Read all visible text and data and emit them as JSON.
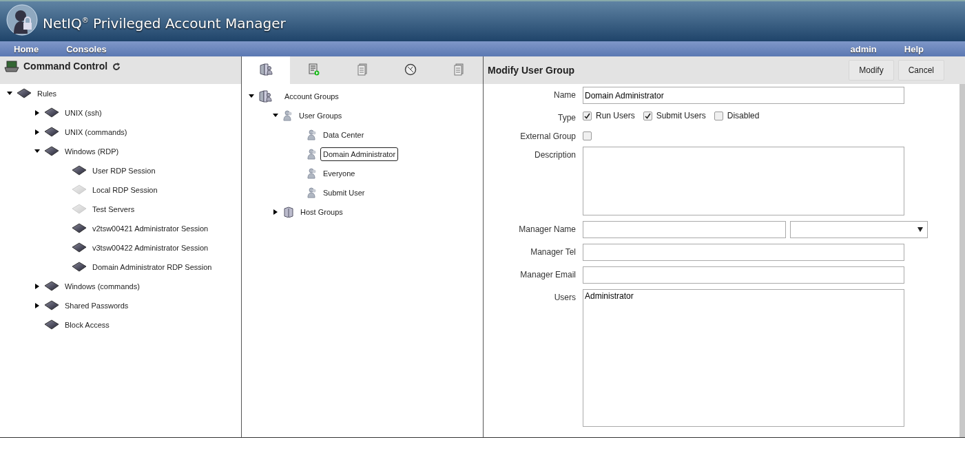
{
  "app": {
    "title": "NetIQ$^{®}$ Privileged Account Manager"
  },
  "nav": {
    "left": [
      "Home",
      "Consoles"
    ],
    "right": [
      "admin",
      "Help"
    ]
  },
  "left_panel": {
    "title": "Command Control",
    "tree": [
      {
        "kind": "group",
        "label": "Rules",
        "expanded": true,
        "children": [
          {
            "kind": "group",
            "label": "UNIX (ssh)",
            "expanded": false
          },
          {
            "kind": "group",
            "label": "UNIX (commands)",
            "expanded": false
          },
          {
            "kind": "group",
            "label": "Windows (RDP)",
            "expanded": true,
            "children": [
              {
                "kind": "rule",
                "label": "User RDP Session",
                "disabled": false
              },
              {
                "kind": "rule",
                "label": "Local RDP Session",
                "disabled": true
              },
              {
                "kind": "rule",
                "label": "Test Servers",
                "disabled": true
              },
              {
                "kind": "rule",
                "label": "v2tsw00421 Administrator Session",
                "disabled": false
              },
              {
                "kind": "rule",
                "label": "v3tsw00422 Administrator Session",
                "disabled": false
              },
              {
                "kind": "rule",
                "label": "Domain Administrator RDP Session",
                "disabled": false
              }
            ]
          },
          {
            "kind": "group",
            "label": "Windows (commands)",
            "expanded": false
          },
          {
            "kind": "group",
            "label": "Shared Passwords",
            "expanded": false
          },
          {
            "kind": "rule",
            "label": "Block Access",
            "disabled": false
          }
        ]
      }
    ]
  },
  "middle_panel": {
    "tabs": [
      {
        "kind": "groups",
        "selected": true
      },
      {
        "kind": "script",
        "selected": false
      },
      {
        "kind": "document",
        "selected": false
      },
      {
        "kind": "clock",
        "selected": false
      },
      {
        "kind": "document",
        "selected": false
      }
    ],
    "tree": [
      {
        "kind": "folder",
        "label": "Account Groups",
        "expanded": true,
        "children": [
          {
            "kind": "users",
            "label": "User Groups",
            "expanded": true,
            "children": [
              {
                "kind": "group",
                "label": "Data Center",
                "selected": false
              },
              {
                "kind": "group",
                "label": "Domain Administrator",
                "selected": true
              },
              {
                "kind": "group",
                "label": "Everyone",
                "selected": false
              },
              {
                "kind": "group",
                "label": "Submit User",
                "selected": false
              }
            ]
          },
          {
            "kind": "hosts",
            "label": "Host Groups",
            "expanded": false
          }
        ]
      }
    ]
  },
  "form": {
    "title": "Modify User Group",
    "buttons": [
      "Modify",
      "Cancel"
    ],
    "name": {
      "label": "Name",
      "value": "Domain Administrator"
    },
    "type": {
      "label": "Type",
      "options": [
        {
          "label": "Run Users",
          "checked": true
        },
        {
          "label": "Submit Users",
          "checked": true
        },
        {
          "label": "Disabled",
          "checked": false
        }
      ]
    },
    "external_group": {
      "label": "External Group",
      "checked": false
    },
    "description": {
      "label": "Description"
    },
    "manager_name": {
      "label": "Manager Name"
    },
    "manager_tel": {
      "label": "Manager Tel"
    },
    "manager_email": {
      "label": "Manager Email"
    },
    "users": {
      "label": "Users",
      "value": "Administrator"
    }
  }
}
